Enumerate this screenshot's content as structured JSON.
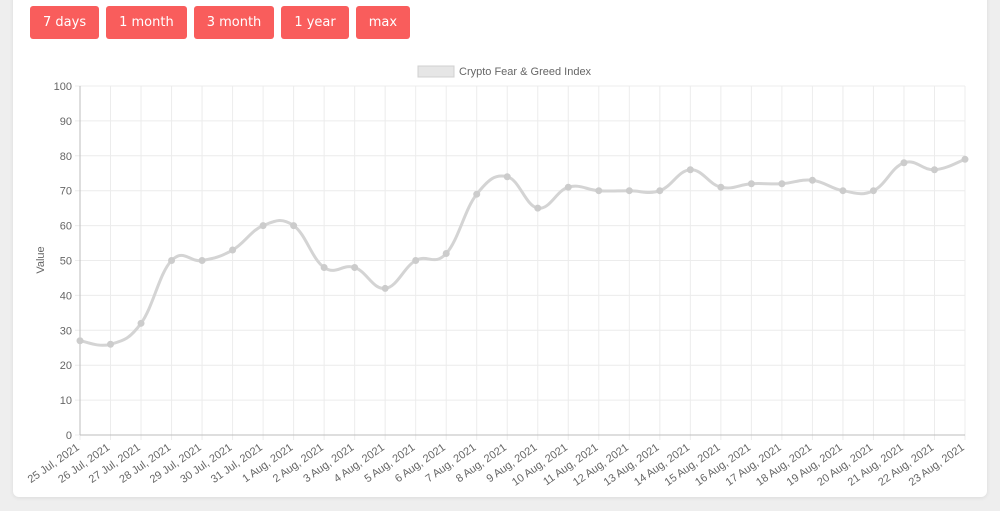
{
  "range_buttons": [
    {
      "label": "7 days"
    },
    {
      "label": "1 month"
    },
    {
      "label": "3 month"
    },
    {
      "label": "1 year"
    },
    {
      "label": "max"
    }
  ],
  "colors": {
    "button_bg": "#f95d5c",
    "line": "#d4d4d4",
    "point": "#cccccc",
    "grid": "#ececec",
    "axis": "#bdbdbd",
    "text": "#666666",
    "page_bg": "#eeeeee",
    "card_bg": "#ffffff"
  },
  "chart_data": {
    "type": "line",
    "title": "",
    "legend": {
      "label": "Crypto Fear & Greed Index",
      "position": "top"
    },
    "xlabel": "",
    "ylabel": "Value",
    "ylim": [
      0,
      100
    ],
    "yticks": [
      0,
      10,
      20,
      30,
      40,
      50,
      60,
      70,
      80,
      90,
      100
    ],
    "grid": true,
    "categories": [
      "25 Jul, 2021",
      "26 Jul, 2021",
      "27 Jul, 2021",
      "28 Jul, 2021",
      "29 Jul, 2021",
      "30 Jul, 2021",
      "31 Jul, 2021",
      "1 Aug, 2021",
      "2 Aug, 2021",
      "3 Aug, 2021",
      "4 Aug, 2021",
      "5 Aug, 2021",
      "6 Aug, 2021",
      "7 Aug, 2021",
      "8 Aug, 2021",
      "9 Aug, 2021",
      "10 Aug, 2021",
      "11 Aug, 2021",
      "12 Aug, 2021",
      "13 Aug, 2021",
      "14 Aug, 2021",
      "15 Aug, 2021",
      "16 Aug, 2021",
      "17 Aug, 2021",
      "18 Aug, 2021",
      "19 Aug, 2021",
      "20 Aug, 2021",
      "21 Aug, 2021",
      "22 Aug, 2021",
      "23 Aug, 2021"
    ],
    "series": [
      {
        "name": "Crypto Fear & Greed Index",
        "values": [
          27,
          26,
          32,
          50,
          50,
          53,
          60,
          60,
          48,
          48,
          42,
          50,
          52,
          69,
          74,
          65,
          71,
          70,
          70,
          70,
          76,
          71,
          72,
          72,
          73,
          70,
          70,
          78,
          76,
          79
        ]
      }
    ]
  }
}
